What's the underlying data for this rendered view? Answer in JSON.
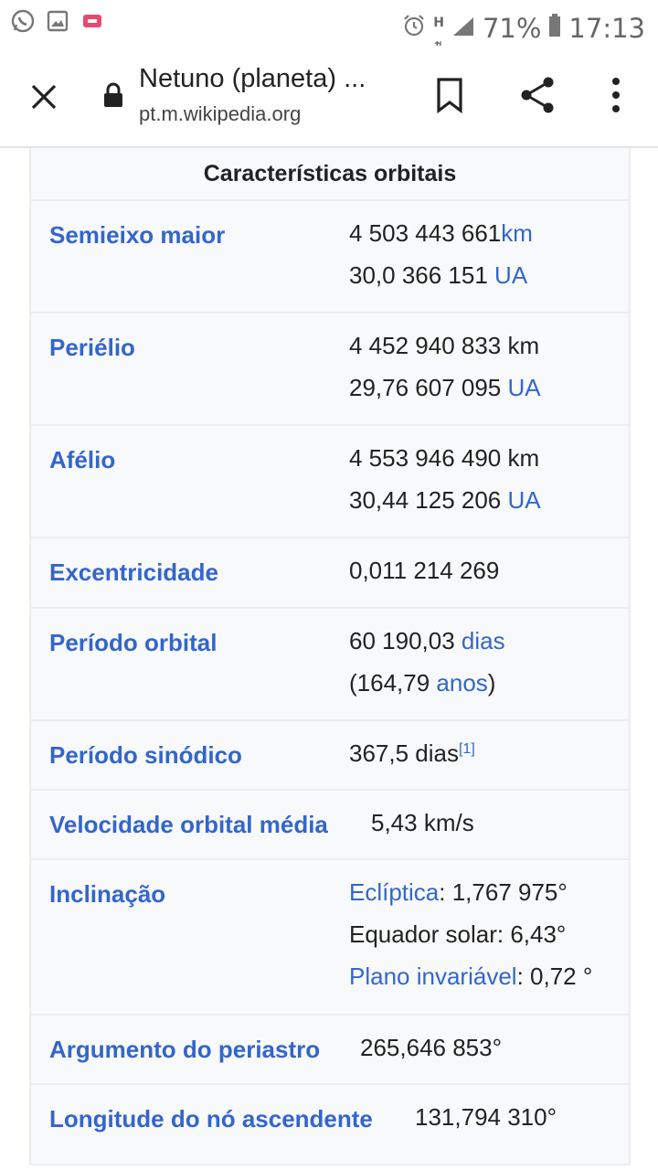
{
  "status_bar": {
    "battery": "71%",
    "time": "17:13",
    "network": "H"
  },
  "toolbar": {
    "title": "Netuno (planeta) ...",
    "url": "pt.m.wikipedia.org"
  },
  "infobox": {
    "header": "Características orbitais",
    "rows": [
      {
        "label": "Semieixo maior",
        "l1a": "4 503 443 661",
        "l1b": "km",
        "l2a": "30,0 366 151 ",
        "l2b": "UA"
      },
      {
        "label": "Periélio",
        "l1a": "4 452 940 833 km",
        "l2a": "29,76 607 095 ",
        "l2b": "UA"
      },
      {
        "label": "Afélio",
        "l1a": "4 553 946 490 km",
        "l2a": "30,44 125 206 ",
        "l2b": "UA"
      },
      {
        "label": "Excentricidade",
        "l1a": "0,011 214 269"
      },
      {
        "label": "Período orbital",
        "l1a": "60 190,03 ",
        "l1b": "dias",
        "l2a": "(164,79 ",
        "l2b": "anos",
        "l2c": ")"
      },
      {
        "label": "Período sinódico",
        "l1a": "367,5 dias",
        "sup": "[1]"
      },
      {
        "label": "Velocidade orbital média",
        "l1a": "5,43 km/s"
      },
      {
        "label": "Inclinação",
        "l1a": "Eclíptica",
        "l1b": ": 1,767 975°",
        "l2a": "Equador solar: 6,43°",
        "l3a": "Plano invariável",
        "l3b": ": 0,72 °"
      },
      {
        "label": "Argumento do periastro",
        "l1a": "265,646 853°"
      },
      {
        "label": "Longitude do nó ascendente",
        "l1a": "131,794 310°"
      }
    ]
  }
}
